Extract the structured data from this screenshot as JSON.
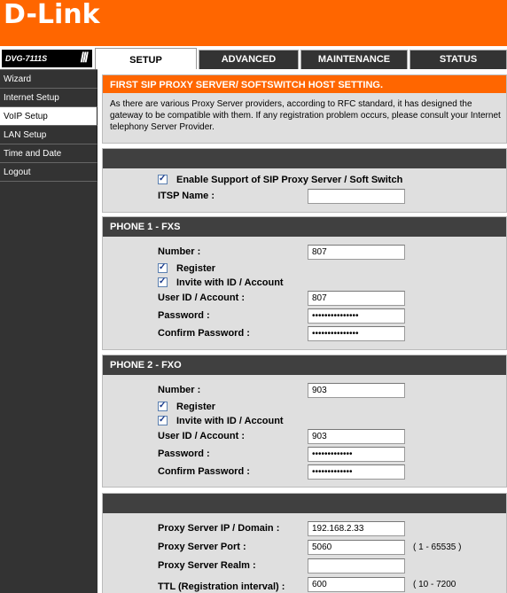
{
  "brand": {
    "logo": "D-Link",
    "model": "DVG-7111S",
    "model_slashes": "///"
  },
  "tabs": [
    {
      "label": "SETUP",
      "active": true
    },
    {
      "label": "ADVANCED"
    },
    {
      "label": "MAINTENANCE"
    },
    {
      "label": "STATUS"
    }
  ],
  "sidebar": {
    "items": [
      {
        "label": "Wizard"
      },
      {
        "label": "Internet Setup"
      },
      {
        "label": "VoIP Setup",
        "active": true
      },
      {
        "label": "LAN Setup"
      },
      {
        "label": "Time and Date"
      },
      {
        "label": "Logout"
      }
    ]
  },
  "intro": {
    "title": "FIRST SIP PROXY SERVER/ SOFTSWITCH HOST SETTING.",
    "description": "As there are various Proxy Server providers, according to RFC standard, it has designed the gateway to be compatible with them. If any registration problem occurs, please consult your Internet telephony Server Provider."
  },
  "sip": {
    "enable_label": "Enable Support of SIP Proxy Server / Soft Switch",
    "enable_checked": true,
    "itsp_label": "ITSP Name :",
    "itsp_value": ""
  },
  "phone1": {
    "title": "PHONE 1 - FXS",
    "number_label": "Number :",
    "number_value": "807",
    "register_label": "Register",
    "register_checked": true,
    "invite_label": "Invite with ID / Account",
    "invite_checked": true,
    "userid_label": "User ID / Account :",
    "userid_value": "807",
    "password_label": "Password :",
    "password_value": "•••••••••••••••",
    "confirm_label": "Confirm Password :",
    "confirm_value": "•••••••••••••••"
  },
  "phone2": {
    "title": "PHONE 2 - FXO",
    "number_label": "Number :",
    "number_value": "903",
    "register_label": "Register",
    "register_checked": true,
    "invite_label": "Invite with ID / Account",
    "invite_checked": true,
    "userid_label": "User ID / Account :",
    "userid_value": "903",
    "password_label": "Password :",
    "password_value": "•••••••••••••",
    "confirm_label": "Confirm Password :",
    "confirm_value": "•••••••••••••"
  },
  "proxy": {
    "ip_label": "Proxy Server IP / Domain :",
    "ip_value": "192.168.2.33",
    "port_label": "Proxy Server Port :",
    "port_value": "5060",
    "port_hint": "( 1 - 65535 )",
    "realm_label": "Proxy Server Realm :",
    "realm_value": "",
    "ttl_label": "TTL (Registration interval) :",
    "ttl_value": "600",
    "ttl_hint": "( 10 - 7200"
  },
  "colors": {
    "accent": "#ff6600",
    "sidebar": "#333333",
    "section_head": "#404040",
    "panel": "#dfdfdf"
  }
}
